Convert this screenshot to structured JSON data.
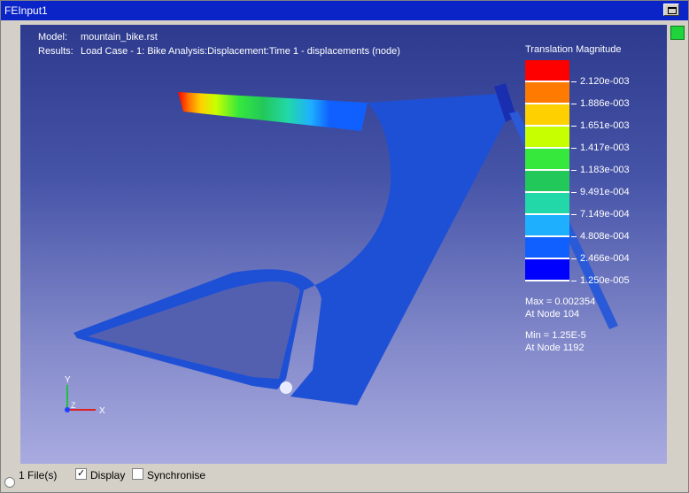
{
  "window": {
    "title": "FEInput1"
  },
  "model": {
    "label": "Model:",
    "value": "mountain_bike.rst"
  },
  "results": {
    "label": "Results:",
    "value": "Load Case - 1: Bike Analysis:Displacement:Time 1 - displacements (node)"
  },
  "legend": {
    "title": "Translation Magnitude",
    "ticks": [
      "2.120e-003",
      "1.886e-003",
      "1.651e-003",
      "1.417e-003",
      "1.183e-003",
      "9.491e-004",
      "7.149e-004",
      "4.808e-004",
      "2.466e-004",
      "1.250e-005"
    ],
    "colors": [
      "#ff0000",
      "#ff7a00",
      "#ffd000",
      "#c8ff00",
      "#36e83c",
      "#22c85a",
      "#22d8a8",
      "#1eb0ff",
      "#1060ff",
      "#0000ff"
    ]
  },
  "stats": {
    "max": "Max = 0.002354",
    "max_node": "At Node 104",
    "min": "Min = 1.25E-5",
    "min_node": "At Node 1192"
  },
  "axes": {
    "y": "Y",
    "x": "X",
    "z": "Z"
  },
  "statusbar": {
    "files": "1 File(s)",
    "display_label": "Display",
    "synchronise_label": "Synchronise",
    "display_checked": true,
    "synchronise_checked": false
  }
}
